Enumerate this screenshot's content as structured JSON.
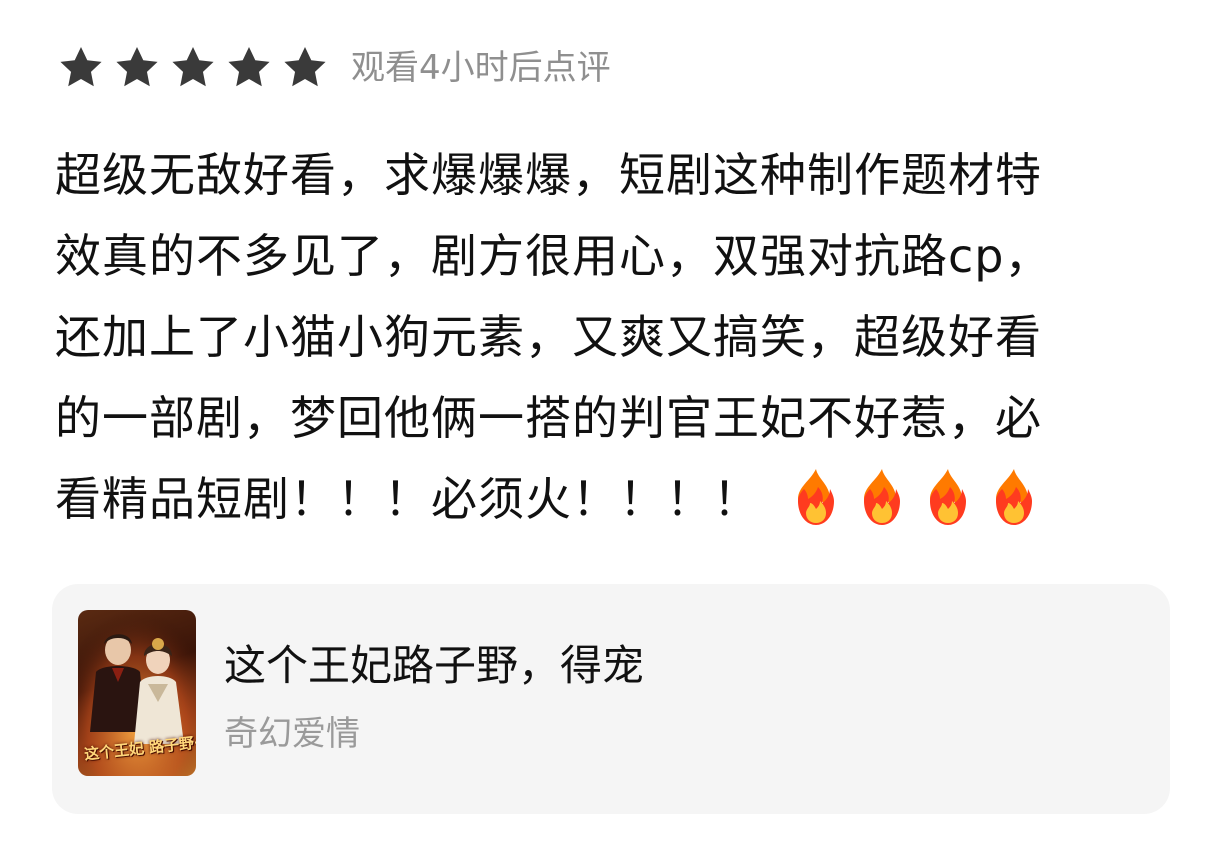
{
  "rating": {
    "stars": 5,
    "max_stars": 5,
    "star_color": "#3a3a3a",
    "watch_note": "观看4小时后点评"
  },
  "review": {
    "lines": [
      "超级无敌好看，求爆爆爆，短剧这种制作题材特",
      "效真的不多见了，剧方很用心，双强对抗路cp，",
      "还加上了小猫小狗元素，又爽又搞笑，超级好看",
      "的一部剧，梦回他俩一搭的判官王妃不好惹，必",
      "看精品短剧！！！必须火！！！！"
    ],
    "emoji_icon": "fire-icon",
    "emoji_count": 4
  },
  "drama": {
    "title": "这个王妃路子野，得宠",
    "genre": "奇幻爱情",
    "poster_text": "这个王妃 路子野·得宠",
    "card_bg": "#f5f5f5"
  }
}
